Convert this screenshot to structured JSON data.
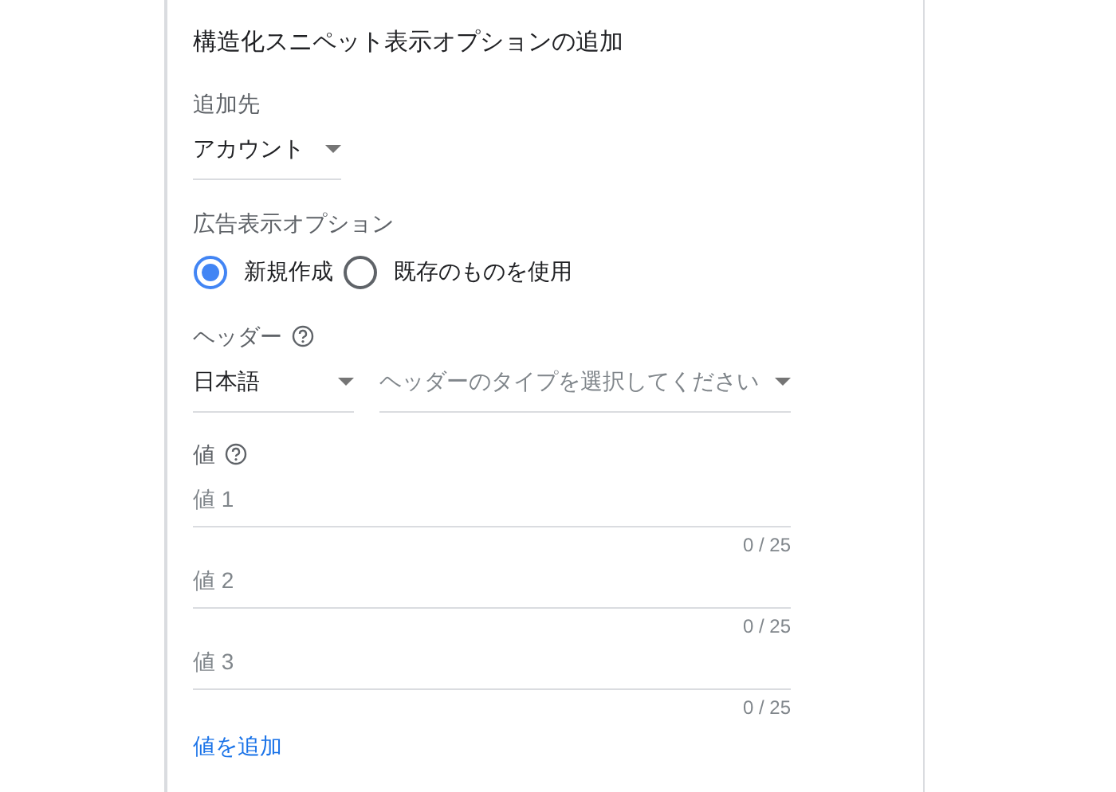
{
  "title": "構造化スニペット表示オプションの追加",
  "destination": {
    "label": "追加先",
    "dropdown": {
      "value": "アカウント"
    }
  },
  "extension": {
    "label": "広告表示オプション",
    "options": [
      {
        "label": "新規作成",
        "selected": true
      },
      {
        "label": "既存のものを使用",
        "selected": false
      }
    ]
  },
  "header": {
    "label": "ヘッダー",
    "language": {
      "value": "日本語"
    },
    "type": {
      "placeholder": "ヘッダーのタイプを選択してください"
    }
  },
  "values": {
    "label": "値",
    "fields": [
      {
        "placeholder": "値 1",
        "counter": "0 / 25"
      },
      {
        "placeholder": "値 2",
        "counter": "0 / 25"
      },
      {
        "placeholder": "値 3",
        "counter": "0 / 25"
      }
    ]
  },
  "add_link": "値を追加"
}
